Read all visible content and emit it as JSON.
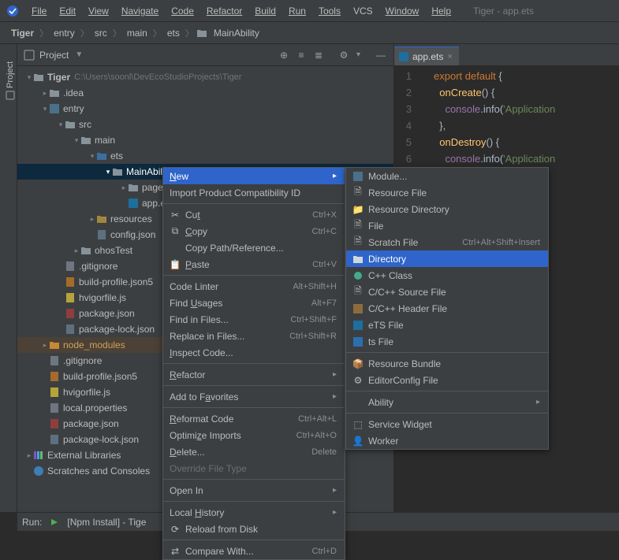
{
  "title_project_hint": "Tiger - app.ets",
  "menu": {
    "file": "File",
    "edit": "Edit",
    "view": "View",
    "navigate": "Navigate",
    "code": "Code",
    "refactor": "Refactor",
    "build": "Build",
    "run": "Run",
    "tools": "Tools",
    "vcs": "VCS",
    "window": "Window",
    "help": "Help"
  },
  "crumbs": {
    "c0": "Tiger",
    "c1": "entry",
    "c2": "src",
    "c3": "main",
    "c4": "ets",
    "c5": "MainAbility"
  },
  "sidebar_label": "Project",
  "project_header": "Project",
  "tree": {
    "tiger": "Tiger",
    "tiger_path": "C:\\Users\\soonl\\DevEcoStudioProjects\\Tiger",
    "idea": ".idea",
    "entry": "entry",
    "src": "src",
    "main": "main",
    "ets": "ets",
    "main_ability": "MainAbility",
    "pages": "pages",
    "appets": "app.ets",
    "resources": "resources",
    "configjson": "config.json",
    "ohostest": "ohosTest",
    "gitignore": ".gitignore",
    "buildprofile": "build-profile.json5",
    "hvigorfile": "hvigorfile.js",
    "packagejson": "package.json",
    "packagelock": "package-lock.json",
    "node_modules": "node_modules",
    "gitignore2": ".gitignore",
    "buildprofile2": "build-profile.json5",
    "hvigorfile2": "hvigorfile.js",
    "localprops": "local.properties",
    "packagejson2": "package.json",
    "packagelock2": "package-lock.json",
    "extlibs": "External Libraries",
    "scratch": "Scratches and Consoles"
  },
  "editor": {
    "tab": "app.ets",
    "l1": "1",
    "l2": "2",
    "l3": "3",
    "l4": "4",
    "l5": "5",
    "l6": "6",
    "code_export": "export default ",
    "code_brace_open": "{",
    "code_onCreate": "onCreate",
    "code_paren": "() {",
    "code_console": "console",
    "code_info": ".info(",
    "code_str": "'Application",
    "code_brace_close": "},",
    "code_onDestroy": "onDestroy"
  },
  "run_label": "Run:",
  "run_task": "[Npm Install] - Tige",
  "ctx1": {
    "new": "New",
    "import": "Import Product Compatibility ID",
    "cut": "Cut",
    "cut_sc": "Ctrl+X",
    "copy": "Copy",
    "copy_sc": "Ctrl+C",
    "copypath": "Copy Path/Reference...",
    "paste": "Paste",
    "paste_sc": "Ctrl+V",
    "codelinter": "Code Linter",
    "codelinter_sc": "Alt+Shift+H",
    "findusages": "Find Usages",
    "findusages_sc": "Alt+F7",
    "findinfiles": "Find in Files...",
    "findinfiles_sc": "Ctrl+Shift+F",
    "replaceinfiles": "Replace in Files...",
    "replaceinfiles_sc": "Ctrl+Shift+R",
    "inspect": "Inspect Code...",
    "refactor": "Refactor",
    "addfav": "Add to Favorites",
    "reformat": "Reformat Code",
    "reformat_sc": "Ctrl+Alt+L",
    "optimports": "Optimize Imports",
    "optimports_sc": "Ctrl+Alt+O",
    "delete": "Delete...",
    "delete_sc": "Delete",
    "override": "Override File Type",
    "openin": "Open In",
    "localhistory": "Local History",
    "reload": "Reload from Disk",
    "comparewith": "Compare With...",
    "comparewith_sc": "Ctrl+D"
  },
  "ctx2": {
    "module": "Module...",
    "resfile": "Resource File",
    "resdir": "Resource Directory",
    "file": "File",
    "scratch": "Scratch File",
    "scratch_sc": "Ctrl+Alt+Shift+Insert",
    "directory": "Directory",
    "cppclass": "C++ Class",
    "csrc": "C/C++ Source File",
    "chdr": "C/C++ Header File",
    "etsfile": "eTS File",
    "tsfile": "ts File",
    "resbundle": "Resource Bundle",
    "editorcfg": "EditorConfig File",
    "ability": "Ability",
    "servicewidget": "Service Widget",
    "worker": "Worker"
  }
}
